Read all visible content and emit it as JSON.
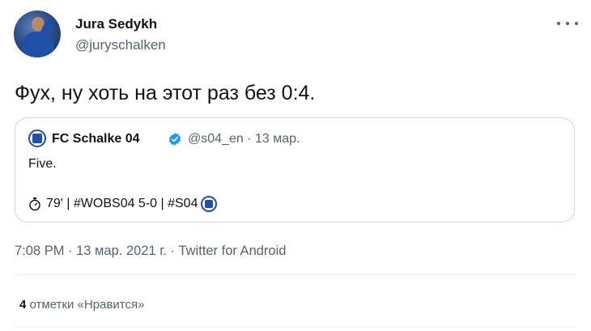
{
  "author": {
    "name": "Jura Sedykh",
    "handle": "@juryschalken"
  },
  "tweet": {
    "text": "Фух, ну хоть на этот раз без 0:4."
  },
  "quoted": {
    "name": "FC Schalke 04",
    "meta": "@s04_en · 13 мар.",
    "line1": "Five.",
    "line2": "79' | #WOBS04 5-0 | #S04",
    "colors": {
      "brand": "#1f4fa8",
      "verified": "#1d9bf0"
    }
  },
  "timestamp": "7:08 PM · 13 мар. 2021 г. · Twitter for Android",
  "likes": {
    "count": "4",
    "label": "отметки «Нравится»"
  },
  "icons": {
    "more": "more-icon",
    "verified": "verified-badge-icon",
    "stopwatch": "stopwatch-icon",
    "team": "schalke-logo-icon"
  }
}
